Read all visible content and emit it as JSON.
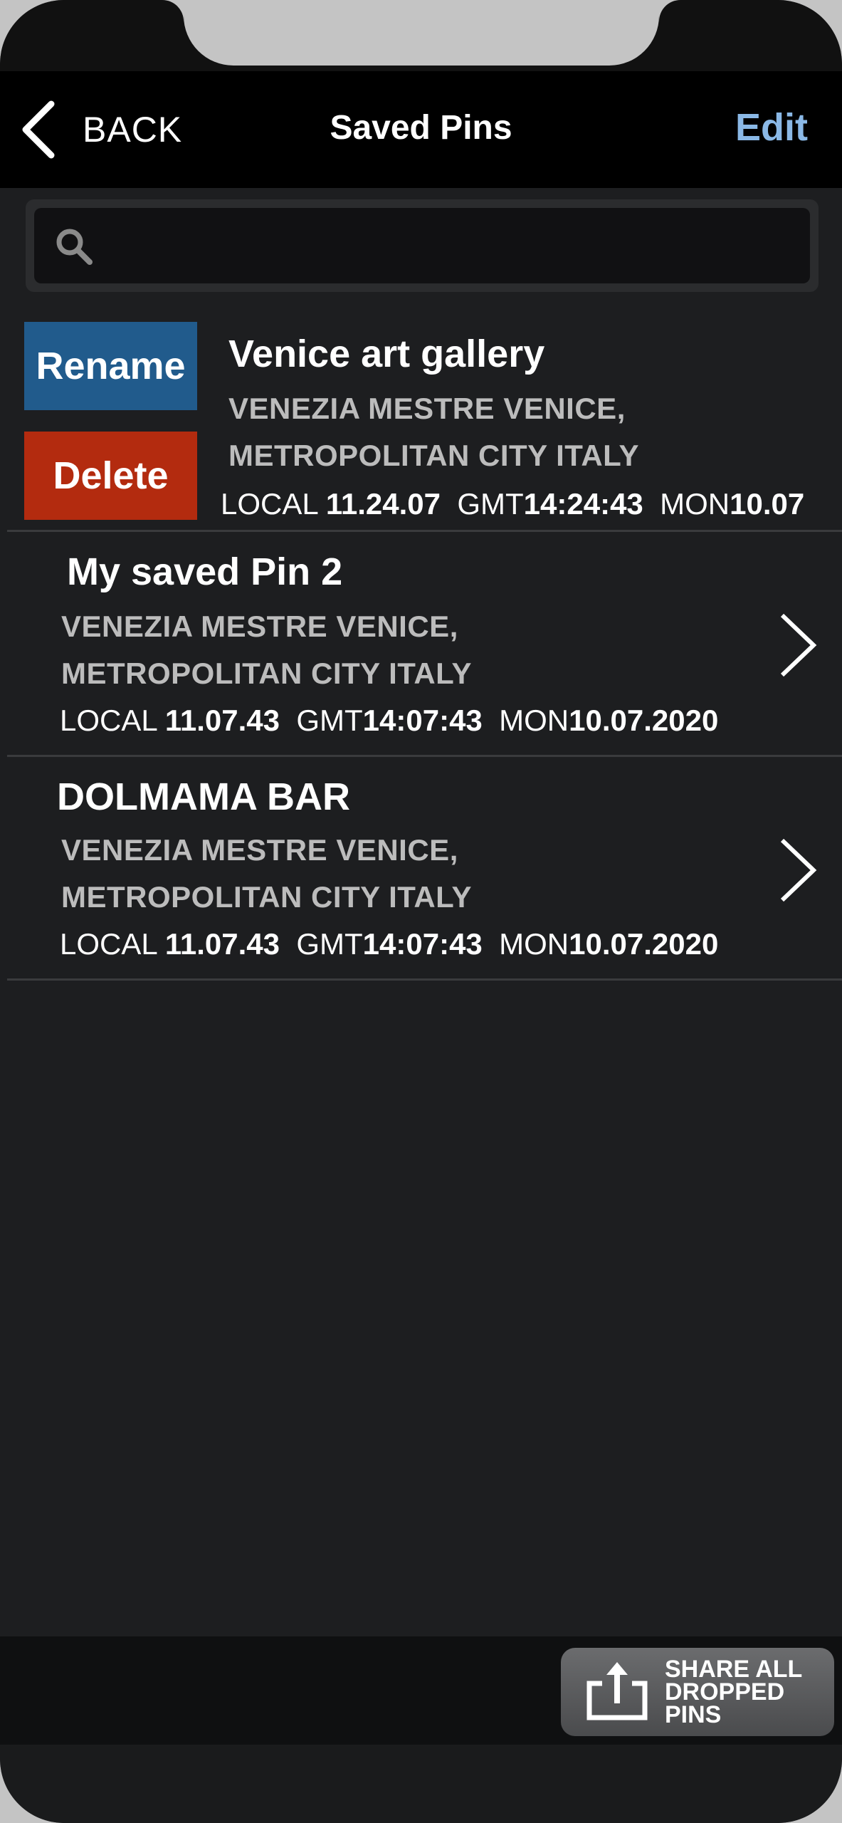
{
  "nav": {
    "back_label": "BACK",
    "title": "Saved Pins",
    "edit_label": "Edit"
  },
  "search": {
    "value": "",
    "placeholder": ""
  },
  "swipe_actions": {
    "rename_label": "Rename",
    "delete_label": "Delete"
  },
  "pins": [
    {
      "title": "Venice art gallery",
      "address_line1": "VENEZIA MESTRE VENICE,",
      "address_line2": "METROPOLITAN CITY  ITALY",
      "local_label": "LOCAL ",
      "local_time": "11.24.07",
      "gmt_label": "  GMT",
      "gmt_time": "14:24:43",
      "day_label": "  MON",
      "date": "10.07"
    },
    {
      "title": "My saved Pin 2",
      "address_line1": "VENEZIA MESTRE VENICE,",
      "address_line2": "METROPOLITAN CITY  ITALY",
      "local_label": "LOCAL ",
      "local_time": "11.07.43",
      "gmt_label": "  GMT",
      "gmt_time": "14:07:43",
      "day_label": "  MON",
      "date": "10.07.2020"
    },
    {
      "title": "DOLMAMA BAR",
      "address_line1": "VENEZIA MESTRE VENICE,",
      "address_line2": "METROPOLITAN CITY  ITALY",
      "local_label": "LOCAL ",
      "local_time": "11.07.43",
      "gmt_label": "  GMT",
      "gmt_time": "14:07:43",
      "day_label": "  MON",
      "date": "10.07.2020"
    }
  ],
  "toolbar": {
    "share_label_line1": "SHARE ALL",
    "share_label_line2": "DROPPED",
    "share_label_line3": "PINS"
  },
  "icons": {
    "back": "chevron-left-icon",
    "search": "search-icon",
    "row_arrow": "chevron-right-icon",
    "share": "share-upload-icon"
  },
  "colors": {
    "edit": "#8ab8e6",
    "rename": "#215b8c",
    "delete": "#b32b0f",
    "background": "#1d1e20"
  }
}
